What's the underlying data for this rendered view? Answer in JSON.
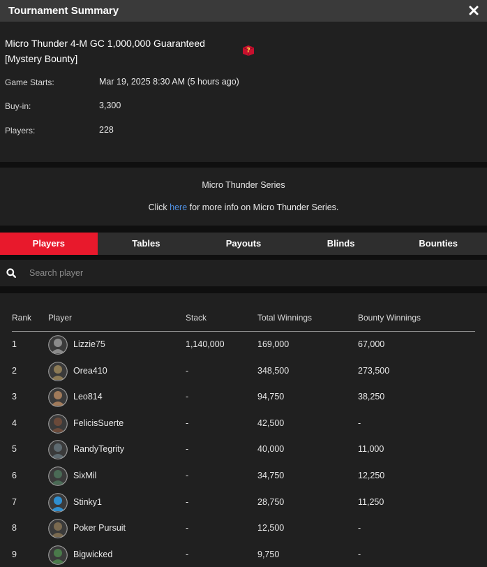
{
  "window": {
    "title": "Tournament Summary"
  },
  "tournament": {
    "name": "Micro Thunder 4-M GC 1,000,000 Guaranteed [Mystery Bounty]",
    "details": [
      {
        "label": "Game Starts:",
        "value": "Mar 19, 2025 8:30 AM (5 hours ago)"
      },
      {
        "label": "Buy-in:",
        "value": "3,300"
      },
      {
        "label": "Players:",
        "value": "228"
      }
    ]
  },
  "series": {
    "name": "Micro Thunder Series",
    "info_prefix": "Click ",
    "info_link": "here",
    "info_suffix": " for more info on Micro Thunder Series."
  },
  "tabs": [
    {
      "label": "Players",
      "active": true
    },
    {
      "label": "Tables",
      "active": false
    },
    {
      "label": "Payouts",
      "active": false
    },
    {
      "label": "Blinds",
      "active": false
    },
    {
      "label": "Bounties",
      "active": false
    }
  ],
  "search": {
    "placeholder": "Search player",
    "value": ""
  },
  "table": {
    "columns": [
      "Rank",
      "Player",
      "Stack",
      "Total Winnings",
      "Bounty Winnings"
    ],
    "rows": [
      {
        "rank": "1",
        "player": "Lizzie75",
        "stack": "1,140,000",
        "total": "169,000",
        "bounty": "67,000",
        "avatar": "#8a8a8a"
      },
      {
        "rank": "2",
        "player": "Orea410",
        "stack": "-",
        "total": "348,500",
        "bounty": "273,500",
        "avatar": "#8c7a55"
      },
      {
        "rank": "3",
        "player": "Leo814",
        "stack": "-",
        "total": "94,750",
        "bounty": "38,250",
        "avatar": "#a07a5a"
      },
      {
        "rank": "4",
        "player": "FelicisSuerte",
        "stack": "-",
        "total": "42,500",
        "bounty": "-",
        "avatar": "#6b4a3a"
      },
      {
        "rank": "5",
        "player": "RandyTegrity",
        "stack": "-",
        "total": "40,000",
        "bounty": "11,000",
        "avatar": "#5e6a70"
      },
      {
        "rank": "6",
        "player": "SixMil",
        "stack": "-",
        "total": "34,750",
        "bounty": "12,250",
        "avatar": "#4a6a55"
      },
      {
        "rank": "7",
        "player": "Stinky1",
        "stack": "-",
        "total": "28,750",
        "bounty": "11,250",
        "avatar": "#2f8fd0"
      },
      {
        "rank": "8",
        "player": "Poker Pursuit",
        "stack": "-",
        "total": "12,500",
        "bounty": "-",
        "avatar": "#7a6a50"
      },
      {
        "rank": "9",
        "player": "Bigwicked",
        "stack": "-",
        "total": "9,750",
        "bounty": "-",
        "avatar": "#4a7a4a"
      }
    ]
  },
  "colors": {
    "accent": "#e8192c",
    "link": "#4f8fe0",
    "panel": "#202020",
    "background": "#0f0f0f"
  }
}
